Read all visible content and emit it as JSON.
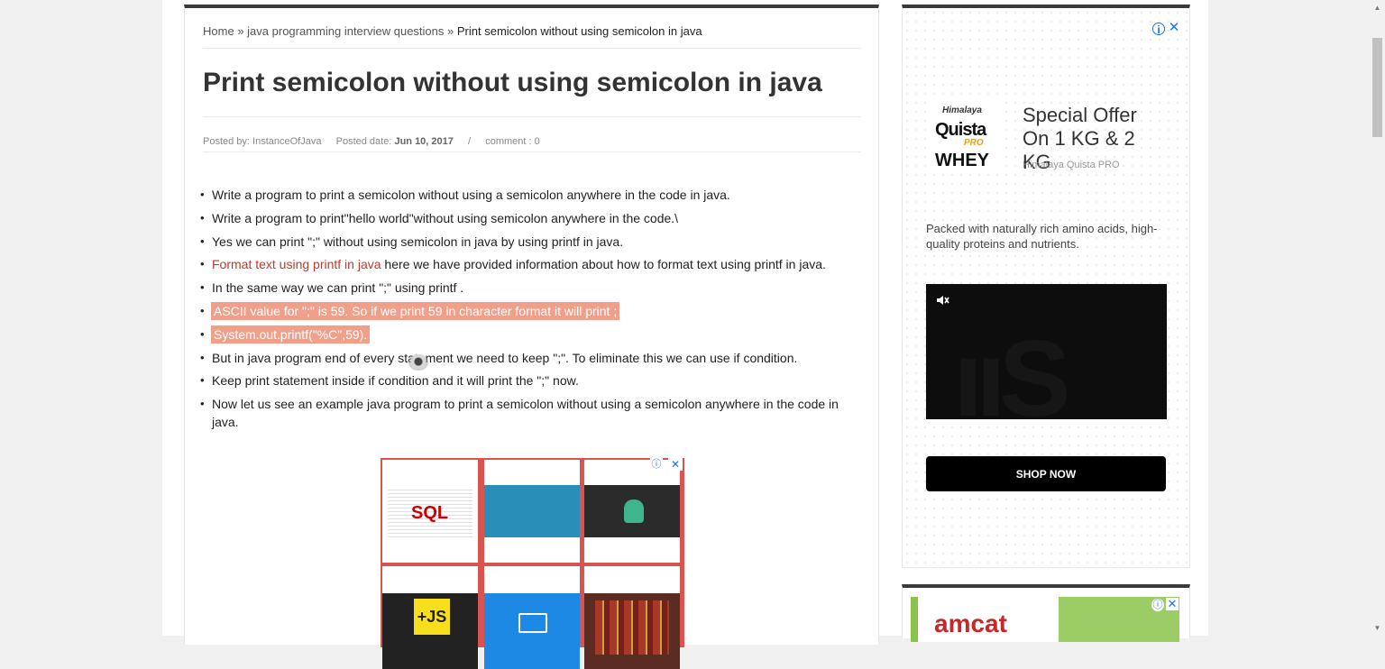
{
  "breadcrumb": {
    "home": "Home",
    "sep1": "»",
    "category": "java programming interview questions",
    "sep2": "»",
    "current": "Print semicolon without using semicolon in java"
  },
  "article": {
    "title": "Print semicolon without using semicolon in java",
    "meta": {
      "posted_by_label": "Posted by:",
      "author": "InstanceOfJava",
      "posted_date_label": "Posted date:",
      "date": "Jun 10, 2017",
      "separator": "/",
      "comments": "comment : 0"
    },
    "bullets": [
      {
        "text": "Write a program to print a semicolon without using a semicolon anywhere in the code in java."
      },
      {
        "text": "Write a program to print\"hello world\"without using semicolon anywhere in the code.\\"
      },
      {
        "text": "Yes we can print \";\" without using semicolon in java by using printf in java."
      },
      {
        "link": "Format text using printf in java",
        "text": " here we have provided information about how to format text using printf in java."
      },
      {
        "text": "In the same way we can print \";\" using printf ."
      },
      {
        "text": "ASCII value for \";\" is 59. So if we print 59 in character format it will print ;"
      },
      {
        "text": "System.out.printf(\"%C\",59)."
      },
      {
        "text": "But in java program end of every statement we need to keep \";\". To eliminate this we can use if condition."
      },
      {
        "text": "Keep print statement inside if condition and it will print the \";\" now."
      },
      {
        "text": "Now let us see an example java program to print a semicolon without using a semicolon anywhere in the code in java."
      }
    ]
  },
  "grid_ad": {
    "info_icon": "info-icon",
    "close_icon": "close-icon",
    "tiles": [
      "SQL",
      "",
      "",
      "+JS",
      "",
      ""
    ]
  },
  "side_ad": {
    "logo": {
      "brand": "Himalaya",
      "name": "Quista",
      "tag": "PRO",
      "product": "WHEY"
    },
    "headline": "Special Offer On 1 KG & 2 KG",
    "advertiser": "Himalaya Quista PRO",
    "description": "Packed with naturally rich amino acids, high-quality proteins and nutrients.",
    "cta": "SHOP NOW",
    "accent": "#000000"
  },
  "amcat_ad": {
    "brand": "amcat"
  },
  "colors": {
    "link": "#c0392b",
    "highlight": "#f0a08a",
    "ad_link": "#1a73e8"
  }
}
